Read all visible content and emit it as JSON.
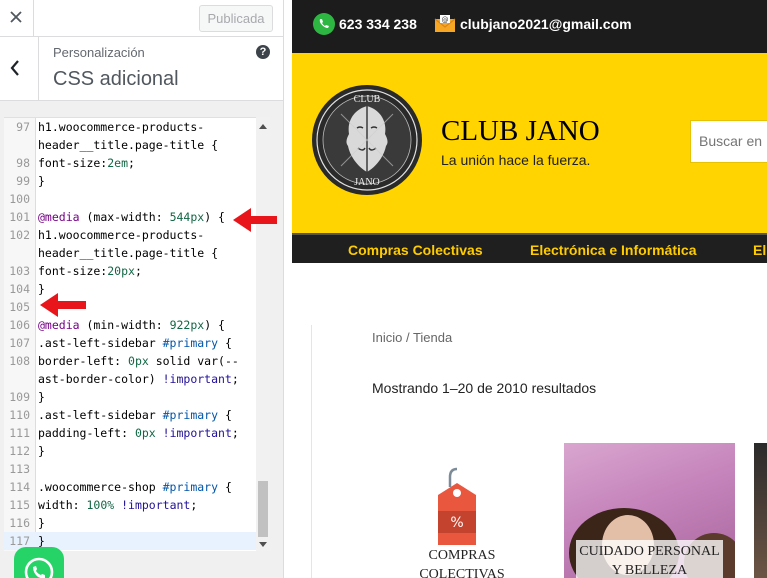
{
  "panel": {
    "publish_label": "Publicada",
    "breadcrumb": "Personalización",
    "title": "CSS adicional",
    "help": "?"
  },
  "code_lines": [
    {
      "n": "97",
      "t": "h1.woocommerce-products-"
    },
    {
      "n": "",
      "t": "header__title.page-title {"
    },
    {
      "n": "98",
      "t": "font-size:2em;"
    },
    {
      "n": "99",
      "t": "}"
    },
    {
      "n": "100",
      "t": ""
    },
    {
      "n": "101",
      "t": "@media (max-width: 544px) {"
    },
    {
      "n": "102",
      "t": "h1.woocommerce-products-"
    },
    {
      "n": "",
      "t": "header__title.page-title {"
    },
    {
      "n": "103",
      "t": "font-size:20px;"
    },
    {
      "n": "104",
      "t": "}"
    },
    {
      "n": "105",
      "t": ""
    },
    {
      "n": "106",
      "t": "@media (min-width: 922px) {"
    },
    {
      "n": "107",
      "t": ".ast-left-sidebar #primary {"
    },
    {
      "n": "108",
      "t": "border-left: 0px solid var(--"
    },
    {
      "n": "",
      "t": "ast-border-color) !important;"
    },
    {
      "n": "109",
      "t": "}"
    },
    {
      "n": "110",
      "t": ".ast-left-sidebar #primary {"
    },
    {
      "n": "111",
      "t": "padding-left: 0px !important;"
    },
    {
      "n": "112",
      "t": "}"
    },
    {
      "n": "113",
      "t": ""
    },
    {
      "n": "114",
      "t": ".woocommerce-shop #primary {"
    },
    {
      "n": "115",
      "t": "width: 100% !important;"
    },
    {
      "n": "116",
      "t": "}"
    },
    {
      "n": "117",
      "t": "}"
    }
  ],
  "colors": {
    "arrow": "#e8151b",
    "brand_yellow": "#ffd400",
    "nav_text": "#ffcc00",
    "topbar": "#1c1c1c"
  },
  "site": {
    "phone": "623 334 238",
    "email": "clubjano2021@gmail.com",
    "logo_text_top": "CLUB",
    "logo_text_bottom": "JANO",
    "title": "CLUB JANO",
    "tagline": "La unión hace la fuerza.",
    "search_placeholder": "Buscar en",
    "nav": [
      "Compras Colectivas",
      "Electrónica e Informática",
      "El"
    ],
    "breadcrumb": "Inicio / Tienda",
    "result_count": "Mostrando 1–20 de 2010 resultados",
    "products": [
      {
        "title_line1": "COMPRAS",
        "title_line2": "COLECTIVAS",
        "icon": "price-tag-icon"
      },
      {
        "title_line1": "CUIDADO PERSONAL",
        "title_line2": "Y BELLEZA"
      }
    ]
  }
}
